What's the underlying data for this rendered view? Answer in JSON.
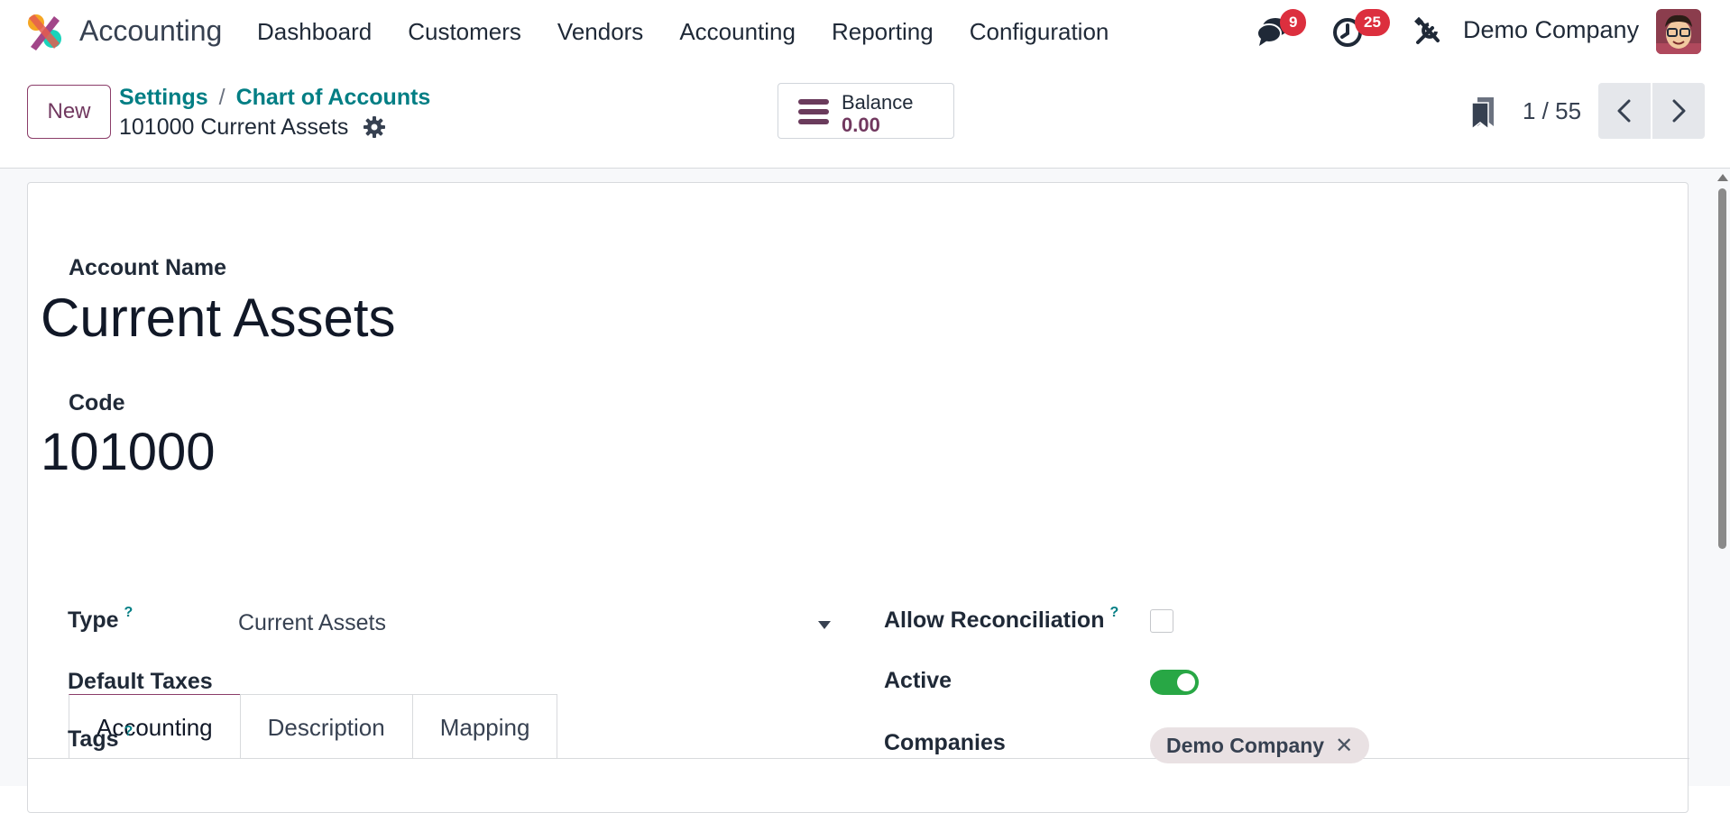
{
  "topnav": {
    "app_name": "Accounting",
    "menu": [
      "Dashboard",
      "Customers",
      "Vendors",
      "Accounting",
      "Reporting",
      "Configuration"
    ],
    "messages_count": "9",
    "activities_count": "25",
    "company": "Demo Company",
    "icons": [
      "app-logo-icon",
      "chat-bubbles-icon",
      "clock-activity-icon",
      "debug-tools-icon",
      "user-avatar"
    ]
  },
  "control": {
    "new_label": "New",
    "breadcrumb": [
      "Settings",
      "Chart of Accounts"
    ],
    "breadcrumb_sep": "/",
    "record_title": "101000 Current Assets",
    "stat": {
      "label": "Balance",
      "value": "0.00"
    },
    "pager": "1 / 55"
  },
  "form": {
    "account_name_label": "Account Name",
    "account_name": "Current Assets",
    "code_label": "Code",
    "code": "101000",
    "tabs": [
      "Accounting",
      "Description",
      "Mapping"
    ],
    "active_tab": "Accounting",
    "fields": {
      "type_label": "Type",
      "type_value": "Current Assets",
      "default_taxes_label": "Default Taxes",
      "tags_label": "Tags",
      "help_mark": "?",
      "allow_reconciliation_label": "Allow Reconciliation",
      "allow_reconciliation": false,
      "active_label": "Active",
      "active": true,
      "companies_label": "Companies",
      "companies": [
        "Demo Company"
      ],
      "remove_mark": "✕"
    }
  },
  "colors": {
    "brand": "#71385f",
    "link": "#017e84",
    "badge": "#dc2f3e",
    "toggle_on": "#28a745"
  }
}
